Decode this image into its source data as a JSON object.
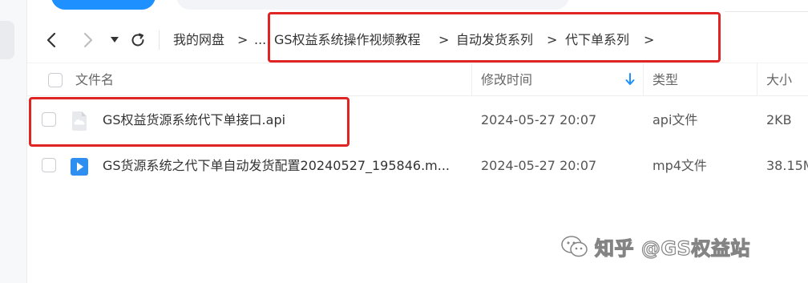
{
  "breadcrumb": {
    "items": [
      {
        "label": "我的网盘"
      },
      {
        "label": "..."
      },
      {
        "label": "GS权益系统操作视频教程"
      },
      {
        "label": "自动发货系列"
      },
      {
        "label": "代下单系列"
      }
    ],
    "separator": ">"
  },
  "nav": {
    "back_icon": "chevron-left-icon",
    "forward_icon": "chevron-right-icon",
    "history_icon": "caret-down-icon",
    "refresh_icon": "refresh-icon"
  },
  "table": {
    "columns": {
      "name": "文件名",
      "modified": "修改时间",
      "type": "类型",
      "size": "大小"
    },
    "sort_icon": "arrow-down-icon",
    "sort_color": "#1e90ff",
    "rows": [
      {
        "name": "GS权益货源系统代下单接口.api",
        "modified": "2024-05-27 20:07",
        "type": "api文件",
        "size": "2KB",
        "icon": "cloud-file-icon"
      },
      {
        "name": "GS货源系统之代下单自动发货配置20240527_195846.m...",
        "modified": "2024-05-27 20:07",
        "type": "mp4文件",
        "size": "38.15M",
        "icon": "video-file-icon"
      }
    ]
  },
  "watermark": {
    "text": "知乎 @GS权益站"
  },
  "colors": {
    "highlight": "#e02424",
    "accent": "#1e90ff"
  }
}
